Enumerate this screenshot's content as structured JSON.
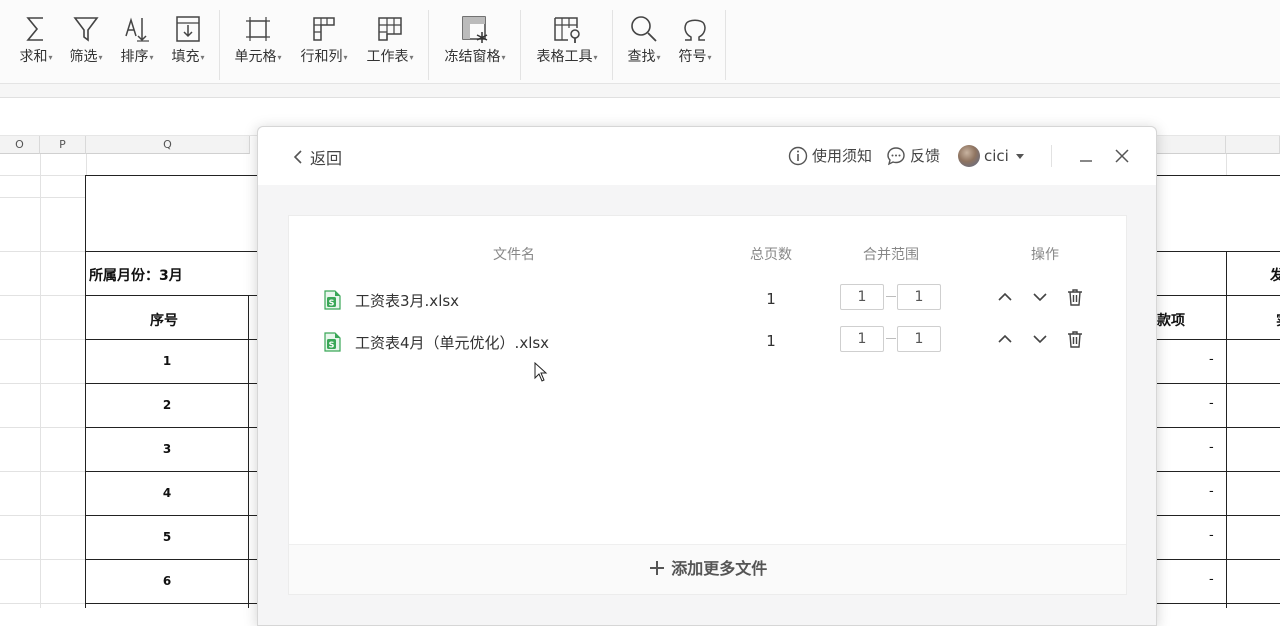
{
  "ribbon": {
    "buttons": [
      {
        "label": "求和",
        "icon": "sum-icon"
      },
      {
        "label": "筛选",
        "icon": "filter-icon"
      },
      {
        "label": "排序",
        "icon": "sort-icon"
      },
      {
        "label": "填充",
        "icon": "fill-icon"
      },
      {
        "label": "单元格",
        "icon": "cell-icon"
      },
      {
        "label": "行和列",
        "icon": "rows-columns-icon"
      },
      {
        "label": "工作表",
        "icon": "worksheet-icon"
      },
      {
        "label": "冻结窗格",
        "icon": "freeze-panes-icon"
      },
      {
        "label": "表格工具",
        "icon": "table-tools-icon"
      },
      {
        "label": "查找",
        "icon": "search-icon"
      },
      {
        "label": "符号",
        "icon": "omega-icon"
      }
    ]
  },
  "sheet": {
    "columns": [
      "O",
      "P",
      "Q"
    ],
    "month_label": "所属月份：3月",
    "seq_header": "序号",
    "row_numbers": [
      "1",
      "2",
      "3",
      "4",
      "5",
      "6"
    ],
    "right_header_1": "款项",
    "right_header_2": "发",
    "right_header_3": "实",
    "dash": "-"
  },
  "dialog": {
    "back_label": "返回",
    "usage_label": "使用须知",
    "feedback_label": "反馈",
    "user_name": "cici",
    "table": {
      "headers": {
        "name": "文件名",
        "pages": "总页数",
        "range": "合并范围",
        "ops": "操作"
      },
      "rows": [
        {
          "name": "工资表3月.xlsx",
          "pages": "1",
          "from": "1",
          "to": "1"
        },
        {
          "name": "工资表4月（单元优化）.xlsx",
          "pages": "1",
          "from": "1",
          "to": "1"
        }
      ]
    },
    "add_more_label": "添加更多文件",
    "colors": {
      "accent_green": "#3aa757",
      "panel_bg": "#f5f5f6"
    }
  }
}
